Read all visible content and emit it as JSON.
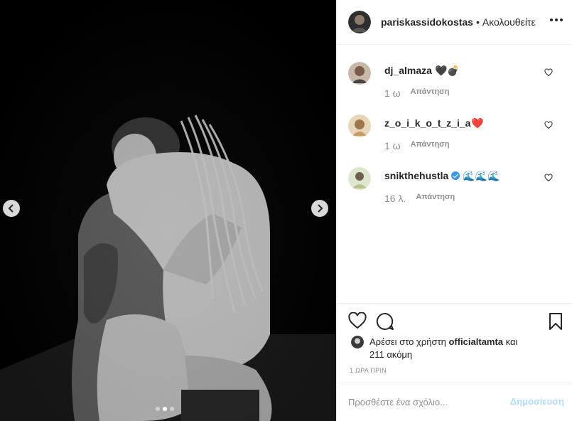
{
  "post": {
    "author": "pariskassidokostas",
    "separator": "•",
    "follow_status": "Ακολουθείτε",
    "image_index": 2,
    "image_count": 3
  },
  "comments": [
    {
      "username": "dj_almaza",
      "text": "🖤💣",
      "time": "1 ω",
      "reply_label": "Απάντηση"
    },
    {
      "username": "z_o_i_k_o_t_z_i_a",
      "text": "❤️",
      "time": "1 ω",
      "reply_label": "Απάντηση"
    },
    {
      "username": "snikthehustla",
      "verified": true,
      "text": "🌊🌊🌊",
      "time": "16 λ.",
      "reply_label": "Απάντηση"
    }
  ],
  "likes": {
    "prefix": "Αρέσει στο χρήστη",
    "user": "officialtamta",
    "conjunction": "και",
    "others": "211 ακόμη"
  },
  "time_ago": "1 ΩΡΑ ΠΡΙΝ",
  "add_comment": {
    "placeholder": "Προσθέστε ένα σχόλιο...",
    "post_label": "Δημοσίευση"
  },
  "icons": {
    "prev": "chevron-left-icon",
    "next": "chevron-right-icon",
    "more": "more-horizontal-icon",
    "like": "heart-icon",
    "comment": "comment-bubble-icon",
    "save": "bookmark-icon"
  },
  "colors": {
    "link_disabled": "#b3dbff",
    "verified": "#3897f0",
    "muted": "#8e8e8e",
    "text": "#262626"
  }
}
